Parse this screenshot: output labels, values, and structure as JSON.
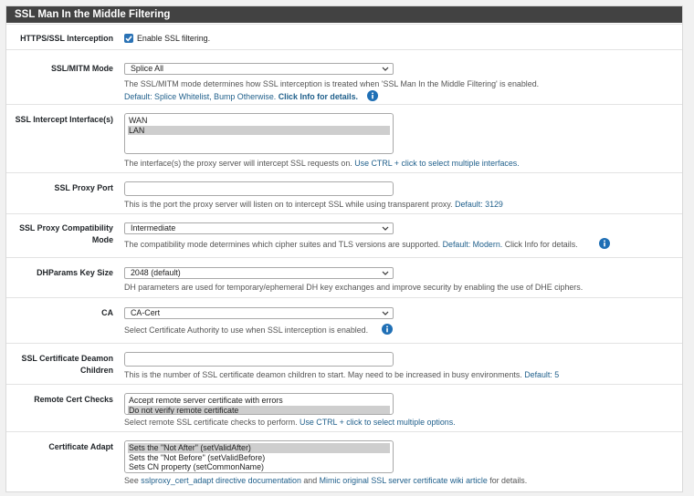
{
  "section": {
    "title": "SSL Man In the Middle Filtering"
  },
  "ssl_filtering": {
    "label": "HTTPS/SSL Interception",
    "checkbox_label": "Enable SSL filtering.",
    "checked": true
  },
  "mitm_mode": {
    "label": "SSL/MITM Mode",
    "value": "Splice All",
    "help_line1": "The SSL/MITM mode determines how SSL interception is treated when 'SSL Man In the Middle Filtering' is enabled.",
    "help_default": "Default: Splice Whitelist, Bump Otherwise.",
    "help_info": "Click Info for details."
  },
  "intercept_interfaces": {
    "label": "SSL Intercept Interface(s)",
    "options": [
      "WAN",
      "LAN"
    ],
    "selected": "LAN",
    "help_text": "The interface(s) the proxy server will intercept SSL requests on.",
    "help_link": "Use CTRL + click to select multiple interfaces."
  },
  "proxy_port": {
    "label": "SSL Proxy Port",
    "value": "",
    "help_text": "This is the port the proxy server will listen on to intercept SSL while using transparent proxy.",
    "help_default": "Default: 3129"
  },
  "compat_mode": {
    "label_line1": "SSL Proxy Compatibility",
    "label_line2": "Mode",
    "value": "Intermediate",
    "help_text": "The compatibility mode determines which cipher suites and TLS versions are supported.",
    "help_default": "Default: Modern.",
    "help_info": "Click Info for details."
  },
  "dhparams": {
    "label": "DHParams Key Size",
    "value": "2048 (default)",
    "help_text": "DH parameters are used for temporary/ephemeral DH key exchanges and improve security by enabling the use of DHE ciphers."
  },
  "ca": {
    "label": "CA",
    "value": "CA-Cert",
    "help_text": "Select Certificate Authority to use when SSL interception is enabled."
  },
  "cert_children": {
    "label_line1": "SSL Certificate Deamon",
    "label_line2": "Children",
    "value": "",
    "help_text": "This is the number of SSL certificate deamon children to start. May need to be increased in busy environments.",
    "help_default": "Default: 5"
  },
  "remote_cert_checks": {
    "label": "Remote Cert Checks",
    "options": [
      "Accept remote server certificate with errors",
      "Do not verify remote certificate"
    ],
    "selected": "Do not verify remote certificate",
    "help_text": "Select remote SSL certificate checks to perform.",
    "help_link": "Use CTRL + click to select multiple options."
  },
  "cert_adapt": {
    "label": "Certificate Adapt",
    "options": [
      "Sets the \"Not After\" (setValidAfter)",
      "Sets the \"Not Before\" (setValidBefore)",
      "Sets CN property (setCommonName)"
    ],
    "selected": "Sets the \"Not After\" (setValidAfter)",
    "help_pre": "See",
    "help_link1": "sslproxy_cert_adapt directive documentation",
    "help_mid": "and",
    "help_link2": "Mimic original SSL server certificate wiki article",
    "help_post": "for details."
  },
  "colors": {
    "heading_bg": "#424242",
    "link": "#1f5f8b",
    "info_icon": "#1f6fb5",
    "checkbox": "#2a72b5"
  }
}
